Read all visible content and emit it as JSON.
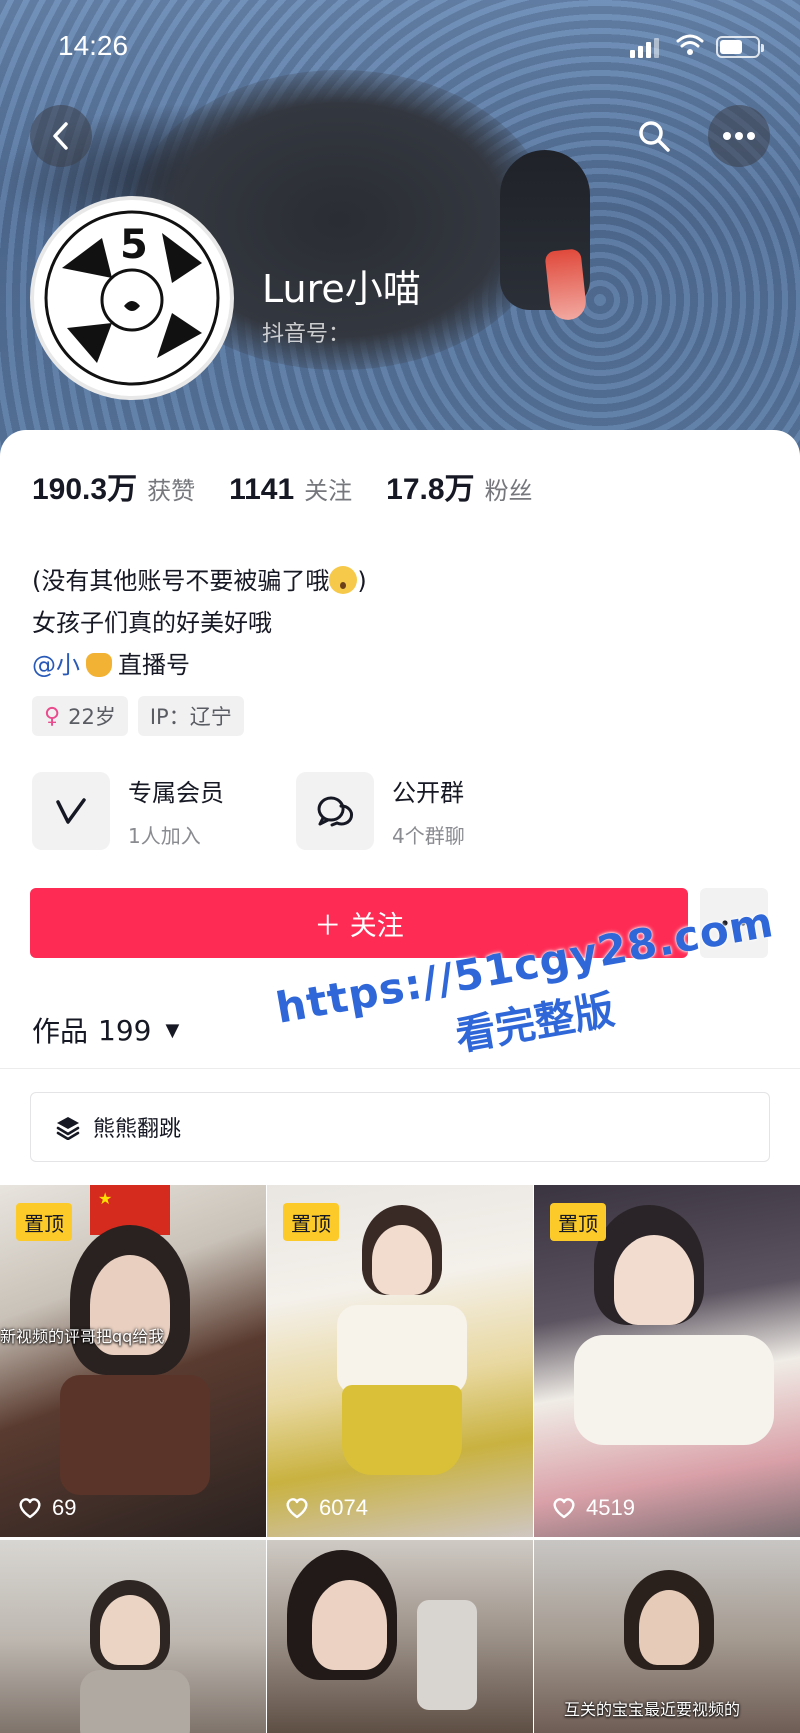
{
  "status_bar": {
    "time": "14:26"
  },
  "profile": {
    "nickname": "Lure小喵",
    "account_id_label": "抖音号：",
    "avatar_text": "5"
  },
  "stats": [
    {
      "value": "190.3万",
      "label": "获赞"
    },
    {
      "value": "1141",
      "label": "关注"
    },
    {
      "value": "17.8万",
      "label": "粉丝"
    }
  ],
  "bio": {
    "line1": "(没有其他账号不要被骗了哦",
    "line1_end": ")",
    "line2": "女孩子们真的好美好哦",
    "mention_prefix": "@小",
    "mention_suffix": "直播号"
  },
  "tags": {
    "age": "22岁",
    "ip": "IP：辽宁"
  },
  "features": [
    {
      "title": "专属会员",
      "subtitle": "1人加入",
      "icon": "v-logo-icon"
    },
    {
      "title": "公开群",
      "subtitle": "4个群聊",
      "icon": "chat-bubble-icon"
    }
  ],
  "actions": {
    "follow_label": "＋ 关注"
  },
  "works": {
    "label": "作品",
    "count": "199"
  },
  "collection": {
    "label": "熊熊翻跳"
  },
  "watermark": {
    "line1": "https://51cgy28.com",
    "line2": "看完整版"
  },
  "videos": [
    {
      "pinned": "置顶",
      "likes": "69",
      "overlay": "新视频的评哥把qq给我"
    },
    {
      "pinned": "置顶",
      "likes": "6074"
    },
    {
      "pinned": "置顶",
      "likes": "4519"
    },
    {},
    {},
    {
      "overlay": "互关的宝宝最近要视频的"
    }
  ],
  "colors": {
    "follow_button": "#fe2c55",
    "pin_badge": "#fccb2a",
    "mention": "#2a5ab8",
    "watermark": "#2f67d8"
  }
}
